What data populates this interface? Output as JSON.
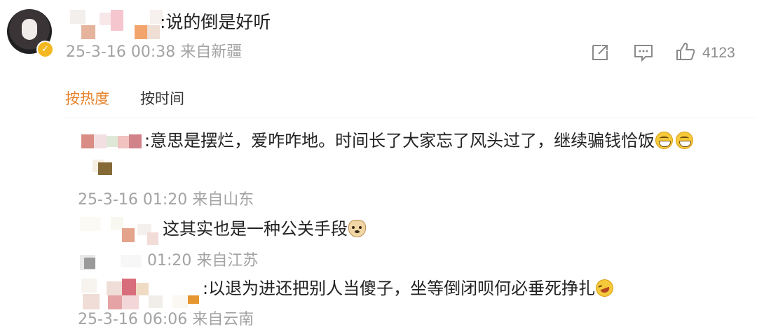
{
  "top_comment": {
    "text": ":说的倒是好听",
    "timestamp": "25-3-16 00:38",
    "location": "来自新疆",
    "like_count": "4123",
    "icons": [
      "share-icon",
      "comment-icon",
      "like-icon"
    ]
  },
  "sort_tabs": {
    "hot": "按热度",
    "time": "按时间",
    "active": "hot"
  },
  "replies": [
    {
      "text": ":意思是摆烂，爱咋咋地。时间长了大家忘了风头过了，继续骗钱恰饭",
      "emojis": [
        "grin-emoji",
        "grin-emoji"
      ],
      "timestamp": "25-3-16 01:20",
      "location": "来自山东"
    },
    {
      "text": "这其实也是一种公关手段",
      "emojis": [
        "doge-emoji"
      ],
      "timestamp": "01:20",
      "location": "来自江苏"
    },
    {
      "text": ":以退为进还把别人当傻子，坐等倒闭呗何必垂死挣扎",
      "emojis": [
        "laugh-emoji"
      ],
      "timestamp": "25-3-16 06:06",
      "location": "来自云南"
    }
  ],
  "colors": {
    "active_tab": "#e8822a",
    "meta_text": "#a3a3a3",
    "body_text": "#222222"
  }
}
